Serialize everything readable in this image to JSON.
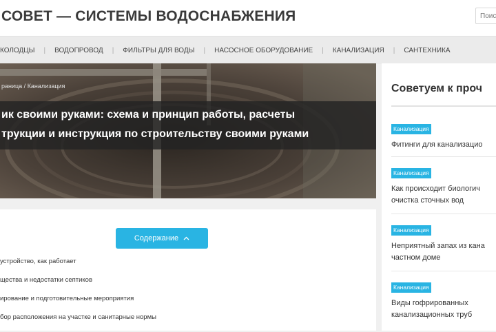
{
  "header": {
    "site_title": "СОВЕТ — СИСТЕМЫ ВОДОСНАБЖЕНИЯ",
    "search_placeholder": "Поиск"
  },
  "nav": {
    "items": [
      {
        "label": "КОЛОДЦЫ"
      },
      {
        "label": "ВОДОПРОВОД"
      },
      {
        "label": "ФИЛЬТРЫ ДЛЯ ВОДЫ"
      },
      {
        "label": "НАСОСНОЕ ОБОРУДОВАНИЕ"
      },
      {
        "label": "КАНАЛИЗАЦИЯ"
      },
      {
        "label": "САНТЕХНИКА"
      }
    ]
  },
  "hero": {
    "breadcrumb_home": "раница",
    "breadcrumb_sep": " / ",
    "breadcrumb_category": "Канализация",
    "title_line1": "ик своими руками: схема и принцип работы, расчеты",
    "title_line2": "трукции и инструкция по строительству своими руками"
  },
  "toc": {
    "button_label": "Содержание",
    "items": [
      {
        "label": "устройство, как работает"
      },
      {
        "label": "щества и недостатки септиков"
      },
      {
        "label": "ирование и подготовительные мероприятия"
      },
      {
        "label": "бор расположения на участке и санитарные нормы"
      }
    ]
  },
  "sidebar": {
    "heading": "Советуем к проч",
    "items": [
      {
        "tag": "Канализация",
        "line1": "Фитинги для канализацио",
        "line2": ""
      },
      {
        "tag": "Канализация",
        "line1": "Как происходит биологич",
        "line2": "очистка сточных вод"
      },
      {
        "tag": "Канализация",
        "line1": "Неприятный запах из кана",
        "line2": "частном доме"
      },
      {
        "tag": "Канализация",
        "line1": "Виды гофрированных",
        "line2": "канализационных труб"
      }
    ]
  },
  "colors": {
    "accent": "#29b4e3",
    "nav_bg": "#ebebeb",
    "title_overlay": "#232323"
  }
}
